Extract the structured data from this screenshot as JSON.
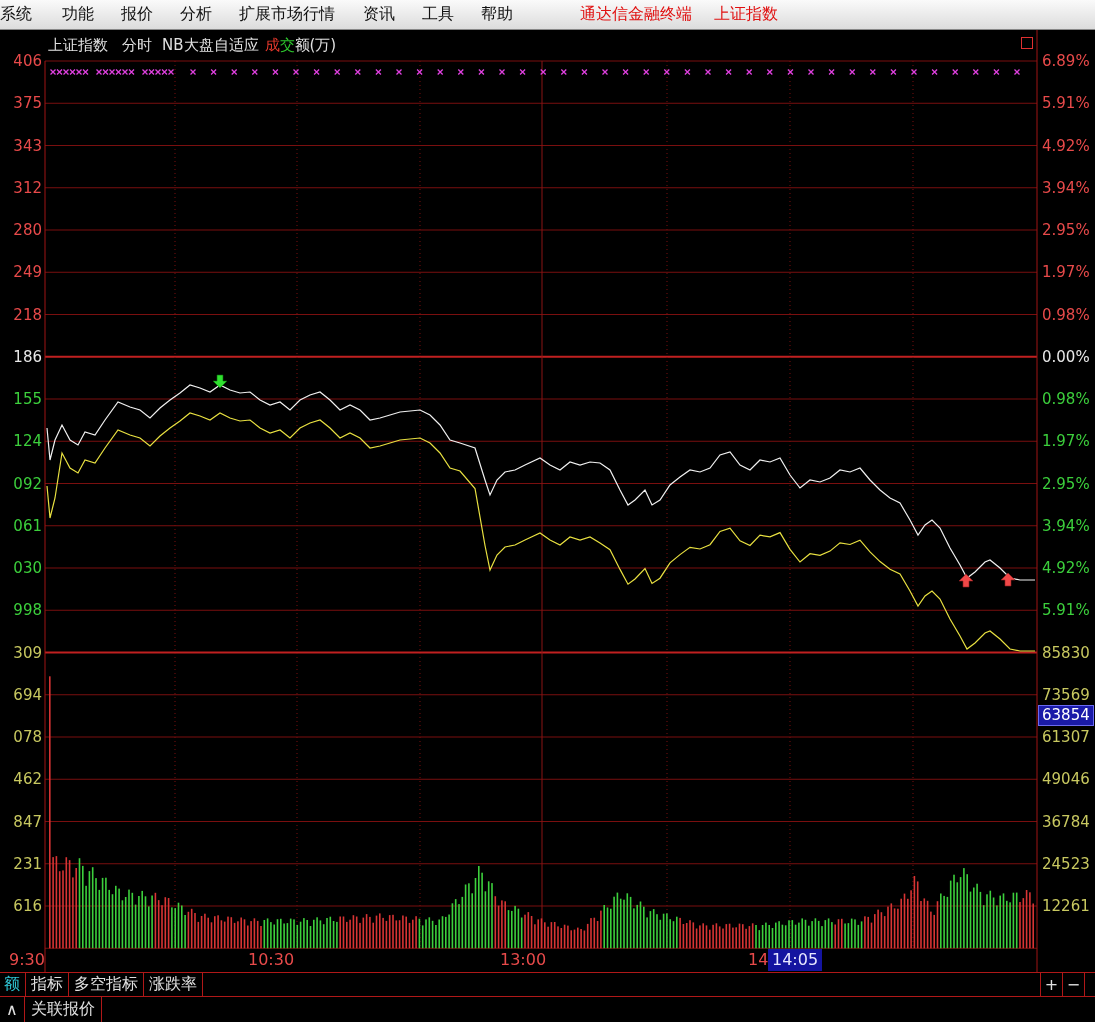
{
  "menu": [
    "系统",
    "功能",
    "报价",
    "分析",
    "扩展市场行情",
    "资讯",
    "工具",
    "帮助"
  ],
  "title": {
    "app": "通达信金融终端",
    "symbol": "上证指数"
  },
  "chart_header": {
    "symbol": "上证指数",
    "period": "分时",
    "indicator": "NB大盘自适应",
    "volume_label": [
      {
        "text": "成",
        "color": "#e8392d"
      },
      {
        "text": "交",
        "color": "#2ec82e"
      },
      {
        "text": "额(万)",
        "color": "#e0e0e0"
      }
    ]
  },
  "left_axis": [
    {
      "label": "406",
      "kind": "up"
    },
    {
      "label": "375",
      "kind": "up"
    },
    {
      "label": "343",
      "kind": "up"
    },
    {
      "label": "312",
      "kind": "up"
    },
    {
      "label": "280",
      "kind": "up"
    },
    {
      "label": "249",
      "kind": "up"
    },
    {
      "label": "218",
      "kind": "up"
    },
    {
      "label": "186",
      "kind": "flat"
    },
    {
      "label": "155",
      "kind": "down"
    },
    {
      "label": "124",
      "kind": "down"
    },
    {
      "label": "092",
      "kind": "down"
    },
    {
      "label": "061",
      "kind": "down"
    },
    {
      "label": "030",
      "kind": "down"
    },
    {
      "label": "998",
      "kind": "down"
    },
    {
      "label": "309",
      "kind": "volume"
    },
    {
      "label": "694",
      "kind": "volume"
    },
    {
      "label": "078",
      "kind": "volume"
    },
    {
      "label": "462",
      "kind": "volume"
    },
    {
      "label": "847",
      "kind": "volume"
    },
    {
      "label": "231",
      "kind": "volume"
    },
    {
      "label": "616",
      "kind": "volume"
    }
  ],
  "right_axis": [
    {
      "label": "6.89%",
      "kind": "up"
    },
    {
      "label": "5.91%",
      "kind": "up"
    },
    {
      "label": "4.92%",
      "kind": "up"
    },
    {
      "label": "3.94%",
      "kind": "up"
    },
    {
      "label": "2.95%",
      "kind": "up"
    },
    {
      "label": "1.97%",
      "kind": "up"
    },
    {
      "label": "0.98%",
      "kind": "up"
    },
    {
      "label": "0.00%",
      "kind": "flat"
    },
    {
      "label": "0.98%",
      "kind": "down"
    },
    {
      "label": "1.97%",
      "kind": "down"
    },
    {
      "label": "2.95%",
      "kind": "down"
    },
    {
      "label": "3.94%",
      "kind": "down"
    },
    {
      "label": "4.92%",
      "kind": "down"
    },
    {
      "label": "5.91%",
      "kind": "down"
    },
    {
      "label": "85830",
      "kind": "volume"
    },
    {
      "label": "73569",
      "kind": "volume"
    },
    {
      "label": "61307",
      "kind": "volume"
    },
    {
      "label": "49046",
      "kind": "volume"
    },
    {
      "label": "36784",
      "kind": "volume"
    },
    {
      "label": "24523",
      "kind": "volume"
    },
    {
      "label": "12261",
      "kind": "volume"
    }
  ],
  "cursor": {
    "value": "63854",
    "time": "14:05"
  },
  "time_axis": [
    "9:30",
    "10:30",
    "13:00",
    "14"
  ],
  "tabs": [
    {
      "label": "额",
      "selected": true
    },
    {
      "label": "指标",
      "selected": false
    },
    {
      "label": "多空指标",
      "selected": false
    },
    {
      "label": "涨跌率",
      "selected": false
    }
  ],
  "zoom_buttons": [
    "+",
    "−"
  ],
  "bottom": {
    "toggle": "∧",
    "link": "关联报价"
  }
}
